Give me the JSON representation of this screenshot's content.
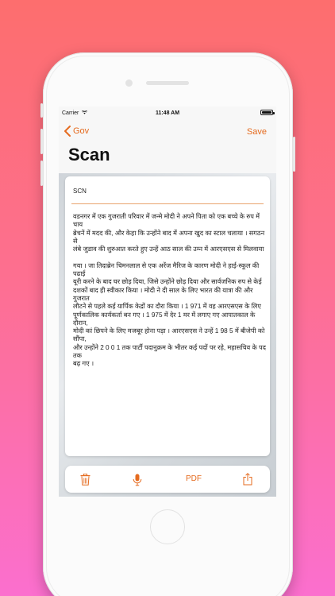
{
  "status_bar": {
    "carrier": "Carrier",
    "time": "11:48 AM"
  },
  "nav": {
    "back_label": "Gov",
    "save_label": "Save",
    "title": "Scan"
  },
  "document": {
    "heading": "SCN",
    "body": "वडनगर में एक गुजराती परिवार में जन्मे मोदी ने अपने पिता को एक बच्चे के रुप में चाय\nब्रेचनें में मदद की, और केहा कि उन्होंने बाद में अपना खुद का स्टाल चलाया । सगठन से\nलंबे जुडाव की शुरुआत करते हुए उन्हें आठ साल की उम्न में आरएसएस से मिलवाया\n\nगया । जा तिदाब्रेन चिमनलाल से एक अरेंज मैरिज के कारण मोदी ने हाई-स्कूल की पढाई\nयूरी करने के बाद घर छोड़ दिया, जिसे उन्होंने छोड़ दिया और सार्वजनिक रुप से केई\nदशकों बाद ही स्वीकार किया । मोदी ने दी साल के लिए भारत की यात्रा की और गुजरात\nलौटने से पहले कई यार्पिक केद्रों का दौरा किया । 1 971 में वह आरएसएस के लिए\nपूर्णकालिक कार्यकर्ता बन गए । 1 975 में देर 1 मर में लगाए गए आपातकाल के दौरान,\nमोदी कां छिपने के लिए मजबूर होना पड़ा । आरएसएस ने उन्हें 1 98 5 में बीजेपी को सौंपा,\nऔर उन्होंने 2 0 0 1 तक पार्टी पदानुक्रम के भीतर कई पदों पर रहे, महासचिव के पद तक\nबढ़ गए ।"
  },
  "toolbar": {
    "pdf_label": "PDF"
  },
  "icons": [
    "chevron-left-icon",
    "wifi-icon",
    "battery-icon",
    "trash-icon",
    "mic-icon",
    "share-icon"
  ],
  "colors": {
    "accent": "#e56b1f",
    "background_top": "#fd6e6e",
    "background_bottom": "#fb6fce"
  }
}
